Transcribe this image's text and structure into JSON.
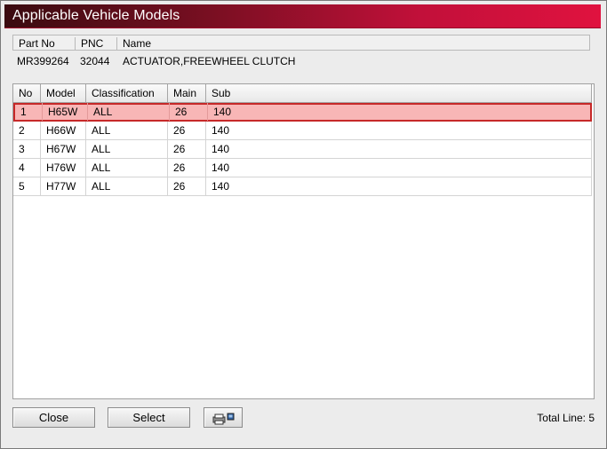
{
  "window": {
    "title": "Applicable Vehicle Models"
  },
  "part_info": {
    "headers": [
      "Part No",
      "PNC",
      "Name"
    ],
    "part_no": "MR399264",
    "pnc": "32044",
    "name": "ACTUATOR,FREEWHEEL CLUTCH"
  },
  "grid": {
    "columns": [
      "No",
      "Model",
      "Classification",
      "Main",
      "Sub"
    ],
    "rows": [
      {
        "no": "1",
        "model": "H65W",
        "classification": "ALL",
        "main": "26",
        "sub": "140",
        "selected": true
      },
      {
        "no": "2",
        "model": "H66W",
        "classification": "ALL",
        "main": "26",
        "sub": "140"
      },
      {
        "no": "3",
        "model": "H67W",
        "classification": "ALL",
        "main": "26",
        "sub": "140"
      },
      {
        "no": "4",
        "model": "H76W",
        "classification": "ALL",
        "main": "26",
        "sub": "140"
      },
      {
        "no": "5",
        "model": "H77W",
        "classification": "ALL",
        "main": "26",
        "sub": "140"
      }
    ]
  },
  "footer": {
    "close_label": "Close",
    "select_label": "Select",
    "print_icon": "printer-icon",
    "total_line": "Total Line: 5"
  },
  "colors": {
    "title_gradient_start": "#3a0b10",
    "title_gradient_end": "#e0123f",
    "selection_fill": "#f8b6b6",
    "selection_border": "#c62828"
  }
}
